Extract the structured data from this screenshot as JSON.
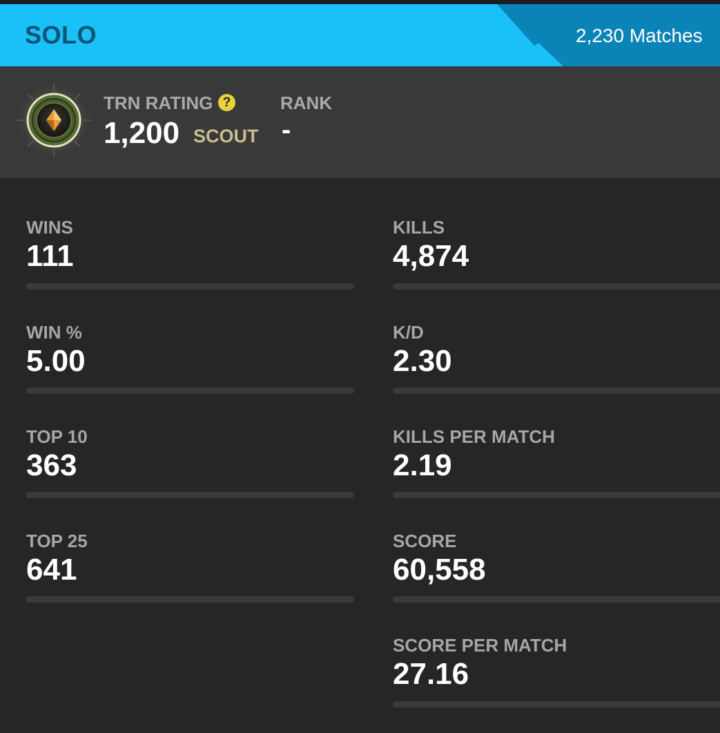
{
  "header": {
    "mode": "SOLO",
    "matches": "2,230 Matches"
  },
  "rating": {
    "trn_label": "TRN RATING",
    "help_glyph": "?",
    "value": "1,200",
    "tier": "SCOUT",
    "rank_label": "RANK",
    "rank_value": "-"
  },
  "colors": {
    "header_light": "#1ac0f8",
    "header_dark": "#0a84b6",
    "title_text": "#0b5474",
    "help_badge": "#e8d33a",
    "tier_text": "#c9bd90"
  },
  "icons": {
    "badge": "scout-rank-badge-icon",
    "help": "help-icon"
  },
  "stats_left": [
    {
      "label": "WINS",
      "value": "111"
    },
    {
      "label": "WIN %",
      "value": "5.00"
    },
    {
      "label": "TOP 10",
      "value": "363"
    },
    {
      "label": "TOP 25",
      "value": "641"
    }
  ],
  "stats_right": [
    {
      "label": "KILLS",
      "value": "4,874"
    },
    {
      "label": "K/D",
      "value": "2.30"
    },
    {
      "label": "KILLS PER MATCH",
      "value": "2.19"
    },
    {
      "label": "SCORE",
      "value": "60,558"
    },
    {
      "label": "SCORE PER MATCH",
      "value": "27.16"
    }
  ]
}
